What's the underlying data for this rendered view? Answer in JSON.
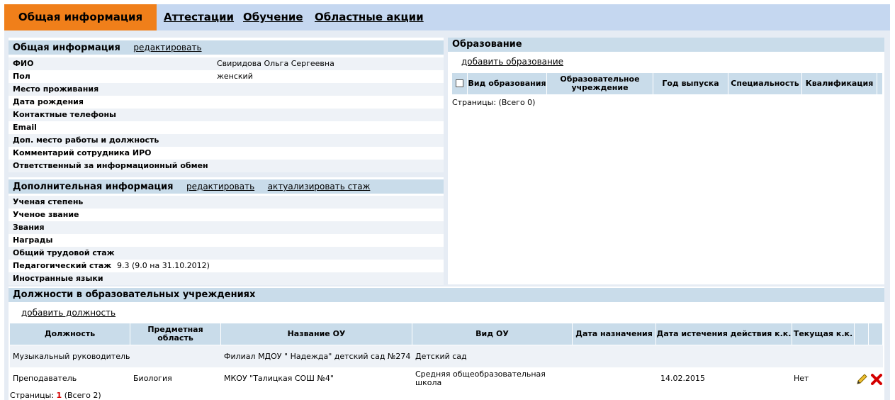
{
  "tabs": {
    "active": "Общая информация",
    "links": [
      "Аттестации",
      "Обучение",
      "Областные акции"
    ]
  },
  "general": {
    "title": "Общая информация",
    "edit_link": "редактировать",
    "rows": [
      {
        "label": "ФИО",
        "value": "Свиридова Ольга Сергеевна"
      },
      {
        "label": "Пол",
        "value": "женский"
      },
      {
        "label": "Место проживания",
        "value": ""
      },
      {
        "label": "Дата рождения",
        "value": ""
      },
      {
        "label": "Контактные телефоны",
        "value": ""
      },
      {
        "label": "Email",
        "value": ""
      },
      {
        "label": "Доп. место работы и должность",
        "value": ""
      },
      {
        "label": "Комментарий сотрудника ИРО",
        "value": ""
      },
      {
        "label": "Ответственный за информационный обмен",
        "value": ""
      }
    ]
  },
  "additional": {
    "title": "Дополнительная информация",
    "edit_link": "редактировать",
    "update_link": "актуализировать стаж",
    "rows": [
      {
        "label": "Ученая степень",
        "value": ""
      },
      {
        "label": "Ученое звание",
        "value": ""
      },
      {
        "label": "Звания",
        "value": ""
      },
      {
        "label": "Награды",
        "value": ""
      },
      {
        "label": "Общий трудовой стаж",
        "value": ""
      },
      {
        "label": "Педагогический стаж",
        "value": "9.3 (9.0 на 31.10.2012)"
      },
      {
        "label": "Иностранные языки",
        "value": ""
      }
    ]
  },
  "education": {
    "title": "Образование",
    "add_link": "добавить образование",
    "columns": [
      "Вид образования",
      "Образовательное учреждение",
      "Год выпуска",
      "Специальность",
      "Квалификация"
    ],
    "pager": "Страницы:  (Всего 0)"
  },
  "positions": {
    "title": "Должности в образовательных учреждениях",
    "add_link": "добавить должность",
    "columns": [
      "Должность",
      "Предметная область",
      "Название ОУ",
      "Вид ОУ",
      "Дата назначения",
      "Дата истечения действия к.к.",
      "Текущая к.к."
    ],
    "rows": [
      [
        "Музыкальный руководитель",
        "",
        "Филиал МДОУ \" Надежда\" детский сад №274",
        "Детский сад",
        "",
        "",
        ""
      ],
      [
        "Преподаватель",
        "Биология",
        "МКОУ \"Талицкая СОШ №4\"",
        "Средняя общеобразовательная школа",
        "",
        "14.02.2015",
        "Нет"
      ]
    ],
    "pager_label": "Страницы:",
    "pager_current": "1",
    "pager_total": "(Всего 2)"
  },
  "icons": {
    "edit": "pencil-icon",
    "delete": "delete-x-icon"
  },
  "colors": {
    "active_tab": "#f07f1a",
    "header": "#c9dcea",
    "tabbar": "#c5d7f0",
    "delete": "#d40000"
  }
}
